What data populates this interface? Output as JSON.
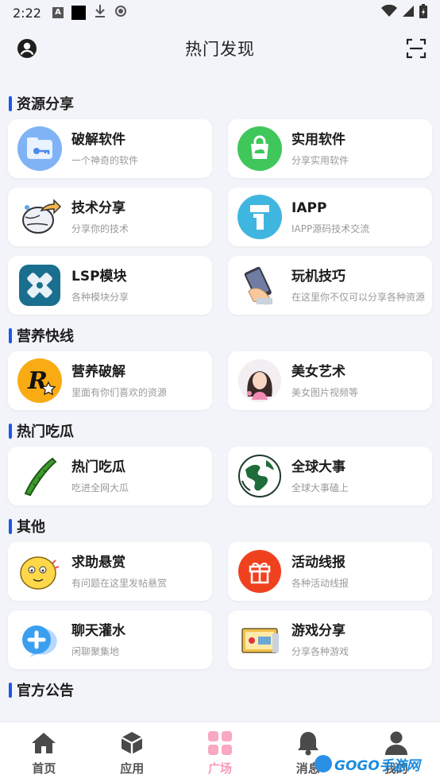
{
  "status_bar": {
    "time": "2:22"
  },
  "header": {
    "title": "热门发现"
  },
  "sections": [
    {
      "title": "资源分享",
      "cards": [
        {
          "name": "破解软件",
          "desc": "一个神奇的软件",
          "icon": "folder-key-icon"
        },
        {
          "name": "实用软件",
          "desc": "分享实用软件",
          "icon": "green-bag-icon"
        },
        {
          "name": "技术分享",
          "desc": "分享你的技术",
          "icon": "share-globe-icon"
        },
        {
          "name": "IAPP",
          "desc": "IAPP源码技术交流",
          "icon": "iapp-icon"
        },
        {
          "name": "LSP模块",
          "desc": "各种模块分享",
          "icon": "lsp-module-icon"
        },
        {
          "name": "玩机技巧",
          "desc": "在这里你不仅可以分享各种资源",
          "icon": "phone-hand-icon"
        }
      ]
    },
    {
      "title": "营养快线",
      "cards": [
        {
          "name": "营养破解",
          "desc": "里面有你们喜欢的资源",
          "icon": "rockstar-r-icon"
        },
        {
          "name": "美女艺术",
          "desc": "美女图片视频等",
          "icon": "girl-avatar-icon"
        }
      ]
    },
    {
      "title": "热门吃瓜",
      "cards": [
        {
          "name": "热门吃瓜",
          "desc": "吃进全网大瓜",
          "icon": "cucumber-icon"
        },
        {
          "name": "全球大事",
          "desc": "全球大事磕上",
          "icon": "earth-icon"
        }
      ]
    },
    {
      "title": "其他",
      "cards": [
        {
          "name": "求助悬赏",
          "desc": "有问题在这里发帖悬赏",
          "icon": "emoji-face-icon"
        },
        {
          "name": "活动线报",
          "desc": "各种活动线报",
          "icon": "gift-icon"
        },
        {
          "name": "聊天灌水",
          "desc": "闲聊聚集地",
          "icon": "chat-plus-icon"
        },
        {
          "name": "游戏分享",
          "desc": "分享各种游戏",
          "icon": "game-card-icon"
        }
      ]
    },
    {
      "title": "官方公告",
      "cards": []
    }
  ],
  "bottom_nav": [
    {
      "label": "首页",
      "icon": "home-icon",
      "active": false
    },
    {
      "label": "应用",
      "icon": "cube-icon",
      "active": false
    },
    {
      "label": "广场",
      "icon": "grid-icon",
      "active": true
    },
    {
      "label": "消息",
      "icon": "bell-icon",
      "active": false
    },
    {
      "label": "我的",
      "icon": "user-icon",
      "active": false
    }
  ],
  "watermark": {
    "text": "GOGO手游网"
  },
  "colors": {
    "accent_bar": "#1e55e8",
    "active_nav": "#f79bb6",
    "background": "#f2f4f9"
  }
}
